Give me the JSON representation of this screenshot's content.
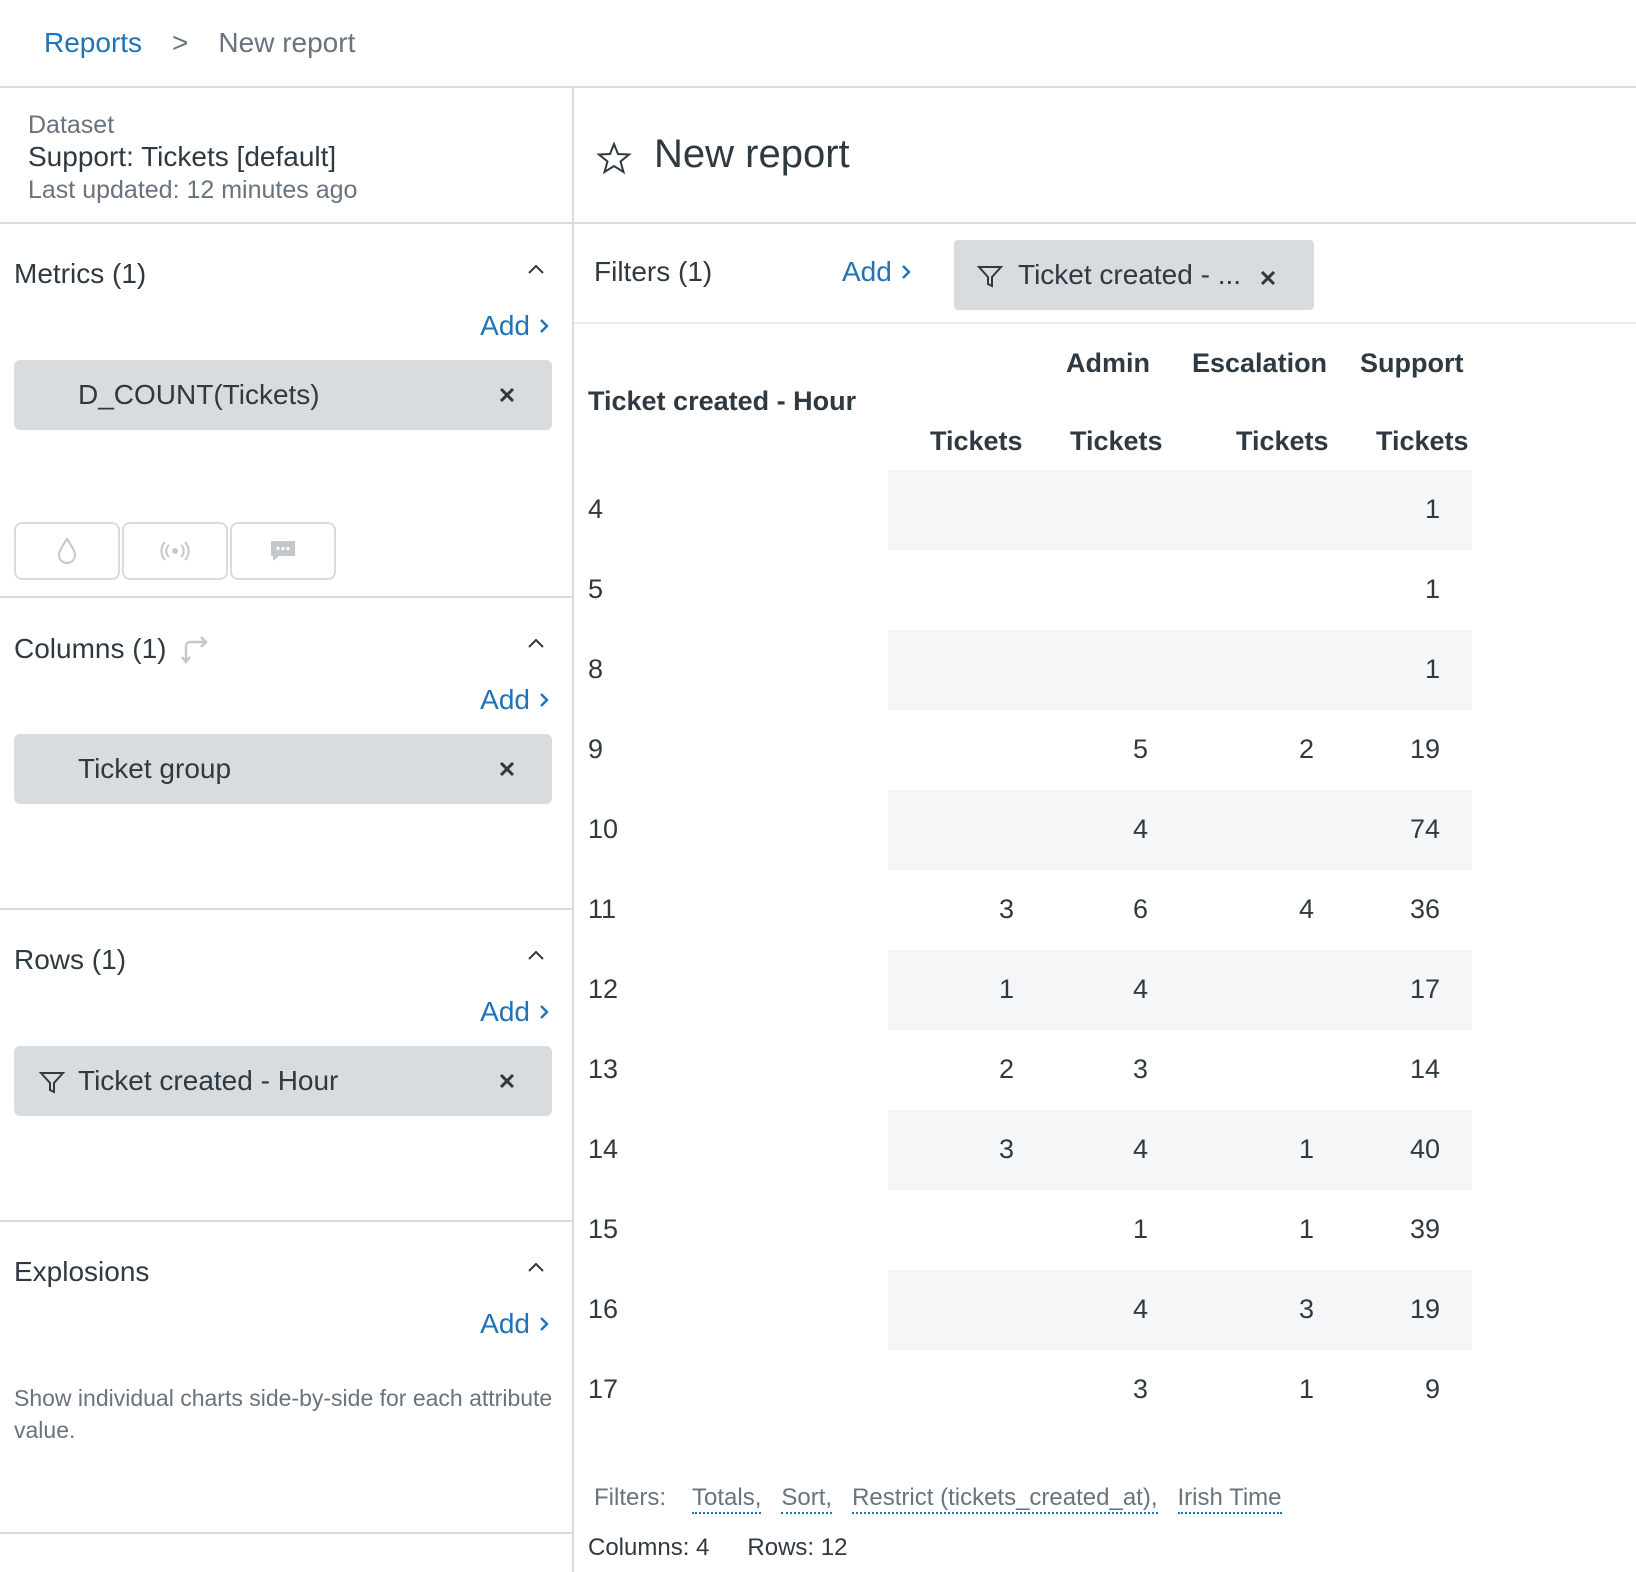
{
  "breadcrumb": {
    "root": "Reports",
    "separator": ">",
    "current": "New report"
  },
  "dataset": {
    "label": "Dataset",
    "name": "Support: Tickets [default]",
    "updated": "Last updated: 12 minutes ago"
  },
  "metrics": {
    "title": "Metrics (1)",
    "add": "Add",
    "items": [
      "D_COUNT(Tickets)"
    ]
  },
  "visualization_icons": [
    "drop-icon",
    "broadcast-icon",
    "chat-icon"
  ],
  "columns": {
    "title": "Columns (1)",
    "add": "Add",
    "items": [
      "Ticket group"
    ]
  },
  "rows": {
    "title": "Rows (1)",
    "add": "Add",
    "items": [
      "Ticket created - Hour"
    ]
  },
  "explosions": {
    "title": "Explosions",
    "add": "Add",
    "description": "Show individual charts side-by-side for each attribute value."
  },
  "report": {
    "title": "New report"
  },
  "filters": {
    "label": "Filters (1)",
    "add": "Add",
    "chip": "Ticket created - ..."
  },
  "table": {
    "row_header": "Ticket created - Hour",
    "group_headers": [
      "",
      "Admin",
      "Escalation",
      "Support"
    ],
    "metric_headers": [
      "Tickets",
      "Tickets",
      "Tickets",
      "Tickets"
    ],
    "rows": [
      {
        "hour": "4",
        "values": [
          "",
          "",
          "",
          "1"
        ]
      },
      {
        "hour": "5",
        "values": [
          "",
          "",
          "",
          "1"
        ]
      },
      {
        "hour": "8",
        "values": [
          "",
          "",
          "",
          "1"
        ]
      },
      {
        "hour": "9",
        "values": [
          "",
          "5",
          "2",
          "19"
        ]
      },
      {
        "hour": "10",
        "values": [
          "",
          "4",
          "",
          "74"
        ]
      },
      {
        "hour": "11",
        "values": [
          "3",
          "6",
          "4",
          "36"
        ]
      },
      {
        "hour": "12",
        "values": [
          "1",
          "4",
          "",
          "17"
        ]
      },
      {
        "hour": "13",
        "values": [
          "2",
          "3",
          "",
          "14"
        ]
      },
      {
        "hour": "14",
        "values": [
          "3",
          "4",
          "1",
          "40"
        ]
      },
      {
        "hour": "15",
        "values": [
          "",
          "1",
          "1",
          "39"
        ]
      },
      {
        "hour": "16",
        "values": [
          "",
          "4",
          "3",
          "19"
        ]
      },
      {
        "hour": "17",
        "values": [
          "",
          "3",
          "1",
          "9"
        ]
      }
    ]
  },
  "footer": {
    "filters_label": "Filters:",
    "filter_links": [
      "Totals,",
      "Sort,",
      "Restrict (tickets_created_at),",
      "Irish Time"
    ],
    "columns": "Columns: 4",
    "rows": "Rows: 12"
  },
  "colors": {
    "link": "#1f73b7",
    "pill": "#d8dcde",
    "band": "#f5f6f7",
    "text": "#2f3941",
    "muted": "#68737d"
  }
}
